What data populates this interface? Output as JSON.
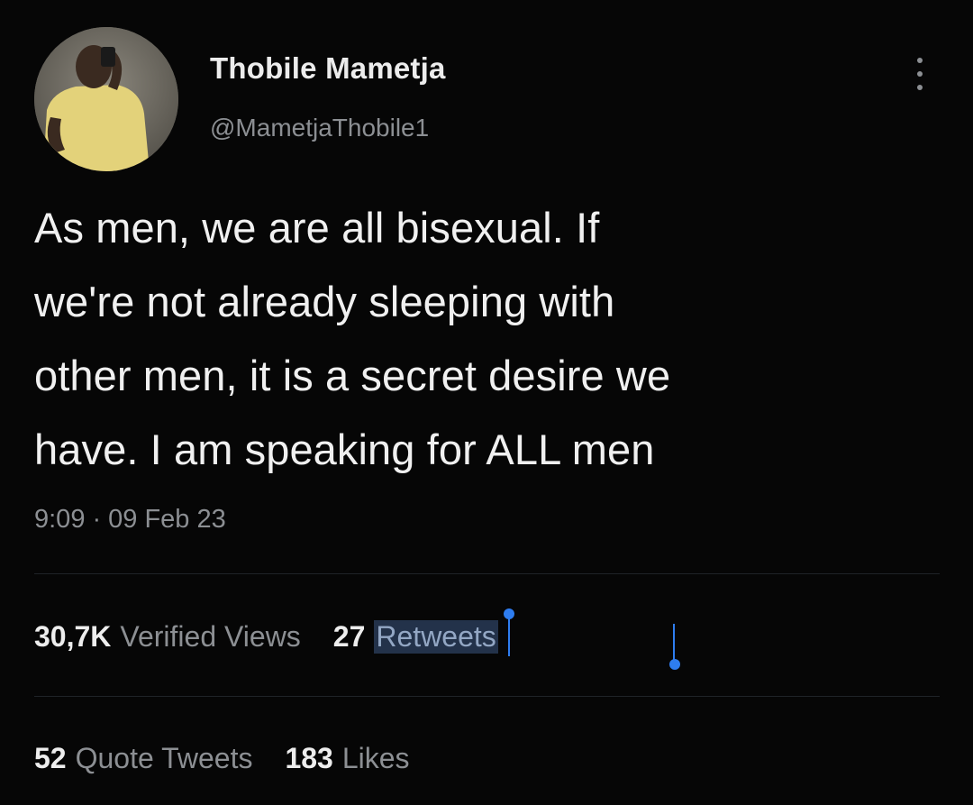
{
  "author": {
    "display_name": "Thobile Mametja",
    "handle": "@MametjaThobile1"
  },
  "tweet": {
    "lines": [
      "As men, we are all bisexual. If",
      "we're not already sleeping with",
      "other men, it is a secret desire we",
      "have. I am speaking for ALL men"
    ],
    "time": "9:09",
    "separator": "·",
    "date": "09 Feb 23"
  },
  "stats": {
    "views_count": "30,7K",
    "views_label": "Verified Views",
    "retweets_count": "27",
    "retweets_label": "Retweets",
    "quotes_count": "52",
    "quotes_label": "Quote Tweets",
    "likes_count": "183",
    "likes_label": "Likes"
  },
  "icons": {
    "more": "more-vertical-icon"
  },
  "colors": {
    "background": "#060606",
    "text_primary": "#f0f0f0",
    "text_secondary": "#8c8f93",
    "selection": "#23324a",
    "selection_handle": "#2e7df0"
  }
}
